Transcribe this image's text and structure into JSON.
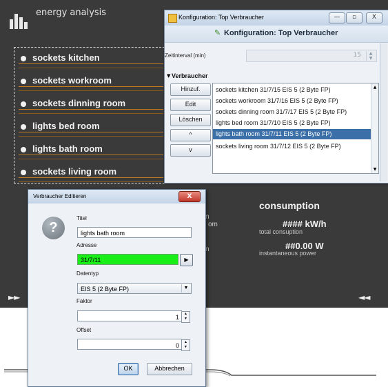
{
  "app": {
    "title": "energy analysis",
    "list_items": [
      "sockets kitchen",
      "sockets workroom",
      "sockets dinning room",
      "lights bed room",
      "lights bath room",
      "sockets living room"
    ],
    "nav_left": "►►",
    "nav_right": "◄◄",
    "consumption": {
      "title": "consumption",
      "total_value": "#### kW/h",
      "total_label": "total consuption",
      "inst_value": "##0.00 W",
      "inst_label": "instantaneous power"
    },
    "fragments": {
      "n1": "n",
      "om": "om",
      "n2": "n"
    }
  },
  "config": {
    "window_title": "Konfiguration: Top Verbraucher",
    "header_title": "Konfiguration: Top Verbraucher",
    "minimize": "—",
    "maximize": "▫",
    "close": "X",
    "interval_label": "Zeitinterval (min)",
    "interval_value": "15",
    "verbraucher_label": "Verbraucher",
    "buttons": {
      "add": "Hinzuf.",
      "edit": "Edit",
      "delete": "Löschen",
      "up": "^",
      "down": "v"
    },
    "rows": [
      "sockets kitchen 31/7/15 EIS 5 (2 Byte FP)",
      "sockets workroom 31/7/16 EIS 5 (2 Byte FP)",
      "sockets dinning room 31/7/17 EIS 5 (2 Byte FP)",
      "lights bed room 31/7/10 EIS 5 (2 Byte FP)",
      "lights bath room 31/7/11 EIS 5 (2 Byte FP)",
      "sockets living room 31/7/12 EIS 5 (2 Byte FP)"
    ],
    "selected_row": 4
  },
  "edit": {
    "window_title": "Verbraucher Editieren",
    "close": "X",
    "titel_label": "Titel",
    "titel_value": "lights bath room",
    "adresse_label": "Adresse",
    "adresse_value": "31/7/11",
    "datentyp_label": "Datentyp",
    "datentyp_value": "EIS 5 (2 Byte FP)",
    "faktor_label": "Faktor",
    "faktor_value": "1",
    "offset_label": "Offset",
    "offset_value": "0",
    "ok": "OK",
    "cancel": "Abbrechen"
  },
  "colors": {
    "address_valid": "#19ee19",
    "selection": "#3a6fa8",
    "app_bg": "#3a3a3a",
    "bar_accent": "#c57b20"
  }
}
